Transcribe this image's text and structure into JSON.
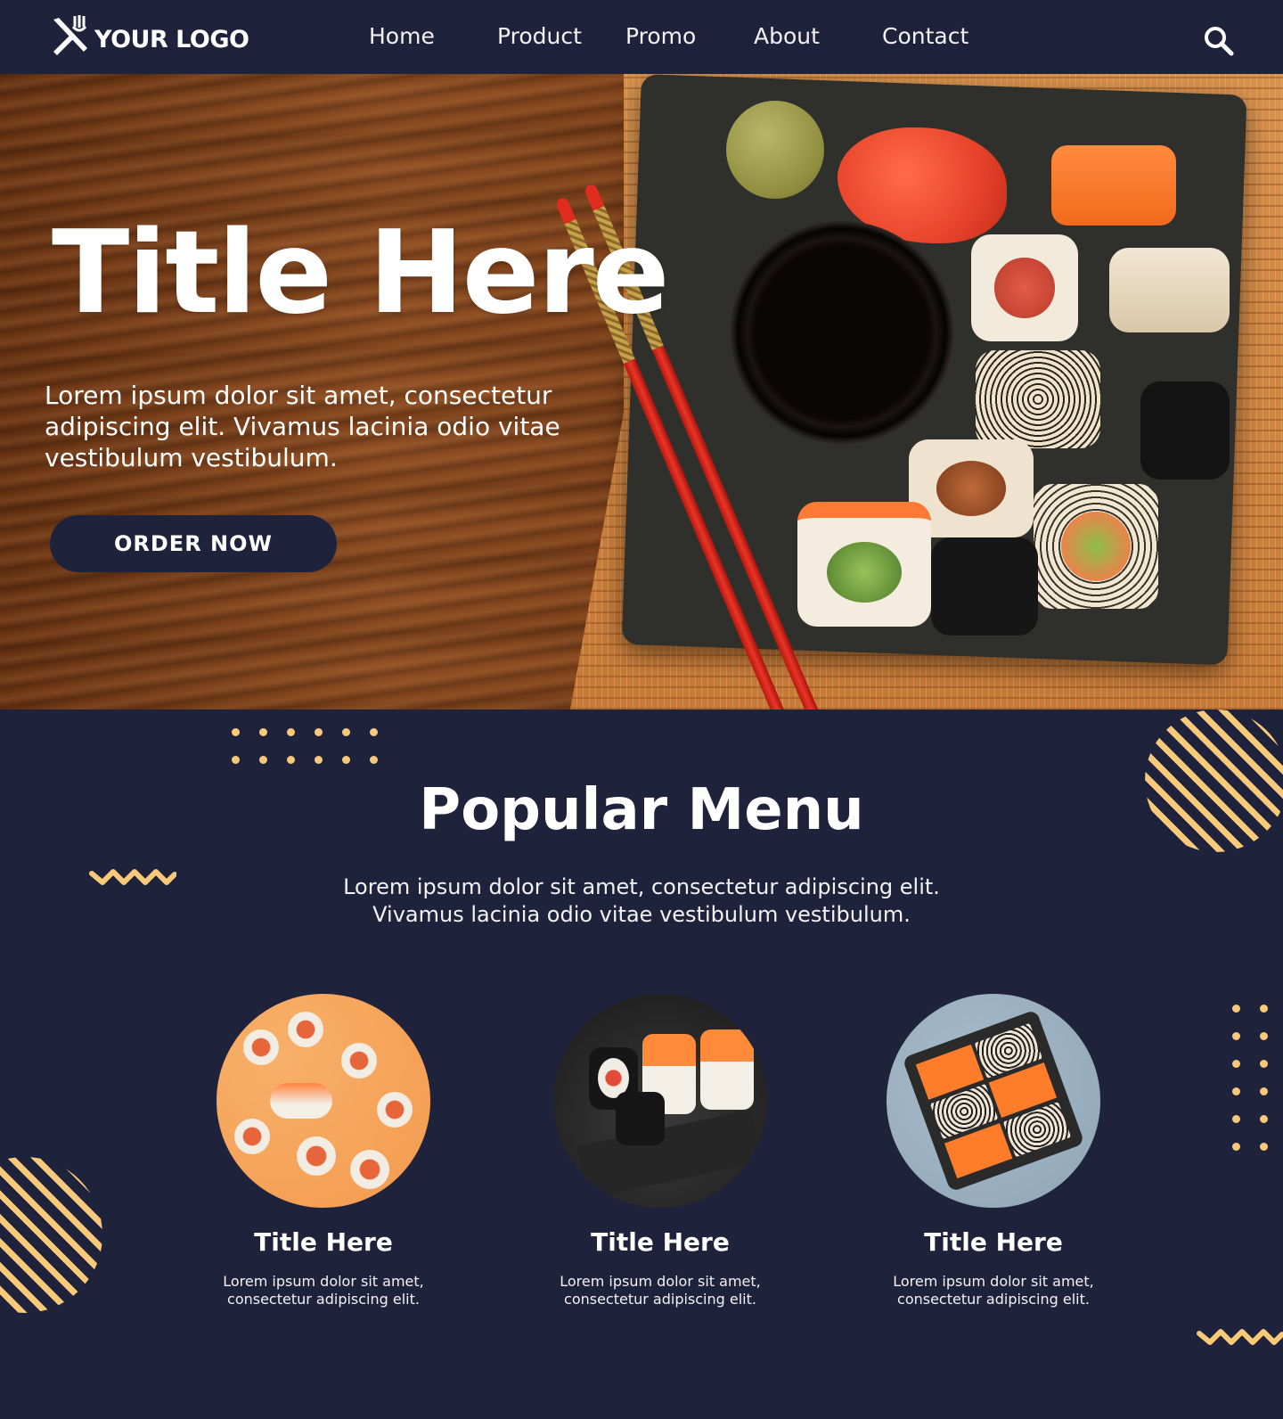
{
  "nav": {
    "logo_text": "YOUR LOGO",
    "items": [
      {
        "label": "Home"
      },
      {
        "label": "Product"
      },
      {
        "label": "Promo"
      },
      {
        "label": "About"
      },
      {
        "label": "Contact"
      }
    ],
    "search_icon": "search-icon"
  },
  "hero": {
    "title": "Title Here",
    "description": "Lorem ipsum dolor sit amet, consectetur adipiscing elit. Vivamus lacinia odio vitae vestibulum vestibulum.",
    "button_label": "ORDER NOW"
  },
  "menu": {
    "title": "Popular Menu",
    "description_line1": "Lorem ipsum dolor sit amet, consectetur adipiscing elit.",
    "description_line2": "Vivamus lacinia odio vitae vestibulum vestibulum.",
    "cards": [
      {
        "title": "Title Here",
        "desc_line1": "Lorem ipsum dolor sit amet,",
        "desc_line2": "consectetur adipiscing elit."
      },
      {
        "title": "Title Here",
        "desc_line1": "Lorem ipsum dolor sit amet,",
        "desc_line2": "consectetur adipiscing elit."
      },
      {
        "title": "Title Here",
        "desc_line1": "Lorem ipsum dolor sit amet,",
        "desc_line2": "consectetur adipiscing elit."
      }
    ]
  },
  "colors": {
    "background": "#1f223b",
    "accent": "#f9c97a",
    "text": "#ffffff"
  }
}
